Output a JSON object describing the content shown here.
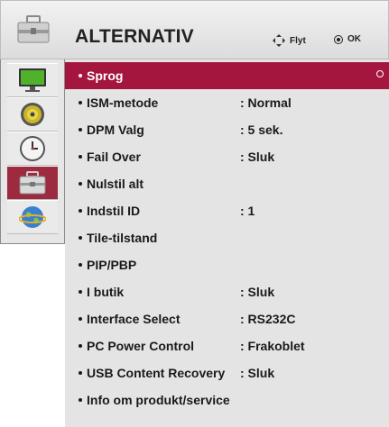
{
  "header": {
    "title": "ALTERNATIV",
    "move_hint": "Flyt",
    "ok_hint": "OK",
    "icon": "toolbox-icon"
  },
  "sidebar": {
    "items": [
      {
        "icon": "monitor-icon"
      },
      {
        "icon": "speaker-icon"
      },
      {
        "icon": "clock-icon"
      },
      {
        "icon": "toolbox-icon",
        "active": true
      },
      {
        "icon": "globe-icon"
      }
    ]
  },
  "menu": {
    "items": [
      {
        "label": "Sprog",
        "value": "",
        "selected": true
      },
      {
        "label": "ISM-metode",
        "value": ": Normal"
      },
      {
        "label": "DPM Valg",
        "value": ": 5 sek."
      },
      {
        "label": "Fail Over",
        "value": ": Sluk"
      },
      {
        "label": "Nulstil alt",
        "value": ""
      },
      {
        "label": "Indstil ID",
        "value": ": 1"
      },
      {
        "label": "Tile-tilstand",
        "value": ""
      },
      {
        "label": "PIP/PBP",
        "value": ""
      },
      {
        "label": "I butik",
        "value": ": Sluk"
      },
      {
        "label": "Interface Select",
        "value": ": RS232C"
      },
      {
        "label": "PC Power Control",
        "value": ": Frakoblet"
      },
      {
        "label": "USB Content Recovery",
        "value": ": Sluk"
      },
      {
        "label": "Info om produkt/service",
        "value": ""
      }
    ]
  },
  "colors": {
    "selected": "#a5163f",
    "sidebar_active": "#9e2a3f",
    "panel": "#e4e4e4"
  }
}
